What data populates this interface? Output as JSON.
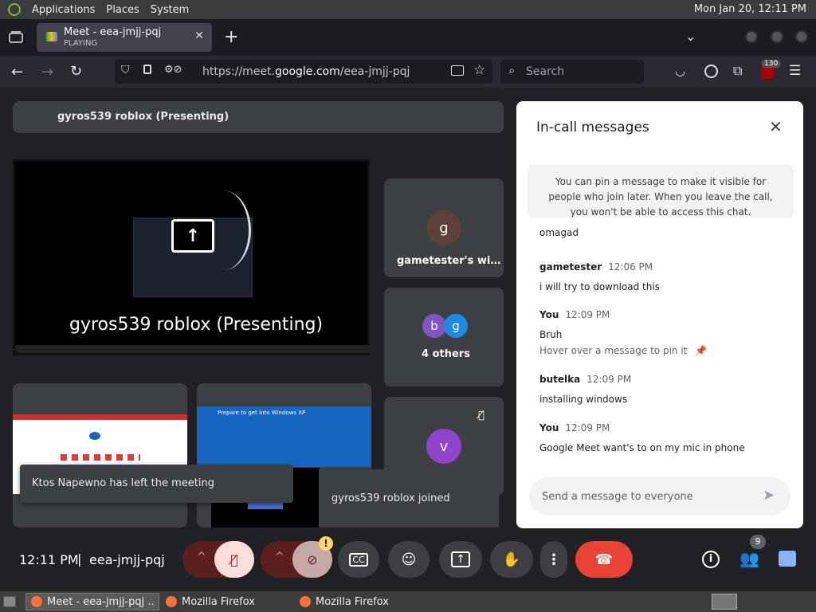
{
  "system": {
    "menu": [
      "Applications",
      "Places",
      "System"
    ],
    "clock": "Mon Jan 20, 12:11 PM"
  },
  "browser": {
    "tab_title": "Meet - eea-jmjj-pqj",
    "tab_status": "PLAYING",
    "url_prefix": "https://meet.",
    "url_domain": "google.com",
    "url_path": "/eea-jmjj-pqj",
    "search_placeholder": "Search",
    "badge_count": "130"
  },
  "meet": {
    "presenting_banner": "gyros539 roblox (Presenting)",
    "presentation_label": "gyros539 roblox (Presenting)",
    "tile_gametester_initial": "g",
    "tile_gametester_label": "gametester's wi…",
    "others_initial_1": "b",
    "others_initial_2": "g",
    "others_label": "4 others",
    "tile_v_initial": "v",
    "toast_left": "Ktos Napewno has left the meeting",
    "toast_joined": "gyros539 roblox joined",
    "screen_preview_text": "Prepare to get into Windows XP",
    "meeting_time": "12:11 PM",
    "separator": "|",
    "meeting_code": "eea-jmjj-pqj",
    "people_count": "9",
    "camera_warning": "!"
  },
  "chat": {
    "title": "In-call messages",
    "pin_info": "You can pin a message to make it visible for people who join later. When you leave the call, you won't be able to access this chat.",
    "first_text": "omagad",
    "messages": [
      {
        "sender": "gametester",
        "time": "12:06 PM",
        "text": "i will try to download this"
      },
      {
        "sender": "You",
        "time": "12:09 PM",
        "text": "Bruh",
        "hint": "Hover over a message to pin it"
      },
      {
        "sender": "butelka",
        "time": "12:09 PM",
        "text": "installing windows"
      },
      {
        "sender": "You",
        "time": "12:09 PM",
        "text": "Google Meet want's to on my mic in phone"
      }
    ],
    "input_placeholder": "Send a message to everyone"
  },
  "taskbar": {
    "items": [
      "Meet - eea-jmjj-pqj ...",
      "Mozilla Firefox",
      "Mozilla Firefox"
    ]
  },
  "colors": {
    "meet_bg": "#202124",
    "tile_bg": "#3c4043",
    "accent_blue": "#1a73e8",
    "end_call_red": "#ea4335",
    "muted_red": "#5c1f1f"
  }
}
